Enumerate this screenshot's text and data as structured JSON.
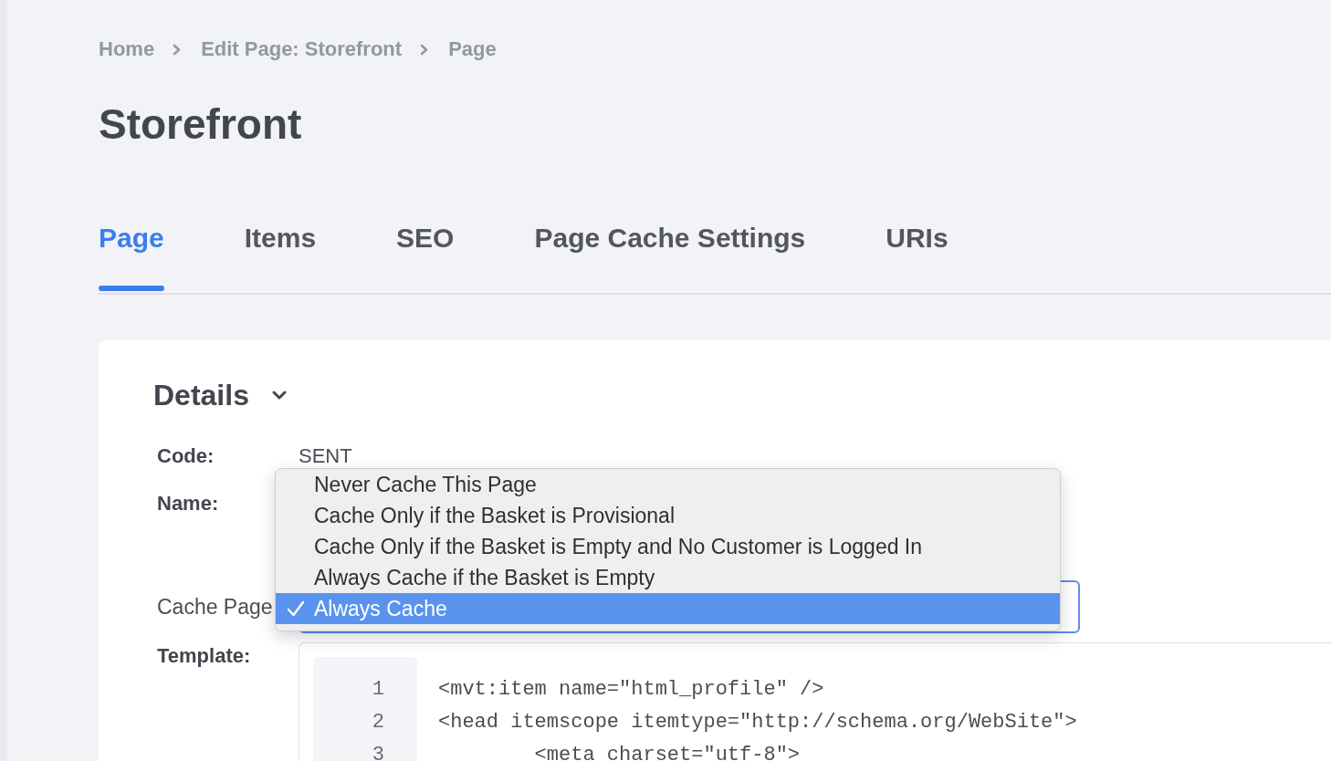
{
  "breadcrumbs": [
    "Home",
    "Edit Page: Storefront",
    "Page"
  ],
  "title": "Storefront",
  "tabs": [
    {
      "label": "Page",
      "selected": true
    },
    {
      "label": "Items",
      "selected": false
    },
    {
      "label": "SEO",
      "selected": false
    },
    {
      "label": "Page Cache Settings",
      "selected": false
    },
    {
      "label": "URIs",
      "selected": false
    }
  ],
  "details": {
    "title": "Details",
    "expanded": true,
    "code": {
      "label": "Code:",
      "value": "SENT"
    },
    "name": {
      "label": "Name:"
    },
    "cache_page": {
      "label": "Cache Page",
      "options": [
        {
          "label": "Never Cache This Page",
          "selected": false
        },
        {
          "label": "Cache Only if the Basket is Provisional",
          "selected": false
        },
        {
          "label": "Cache Only if the Basket is Empty and No Customer is Logged In",
          "selected": false
        },
        {
          "label": "Always Cache if the Basket is Empty",
          "selected": false
        },
        {
          "label": "Always Cache",
          "selected": true
        }
      ]
    },
    "template": {
      "label": "Template:",
      "lines": [
        {
          "number": "1",
          "code": "<mvt:item name=\"html_profile\" />"
        },
        {
          "number": "2",
          "code": "<head itemscope itemtype=\"http://schema.org/WebSite\">"
        },
        {
          "number": "3",
          "code": "        <meta charset=\"utf-8\">"
        }
      ]
    }
  }
}
